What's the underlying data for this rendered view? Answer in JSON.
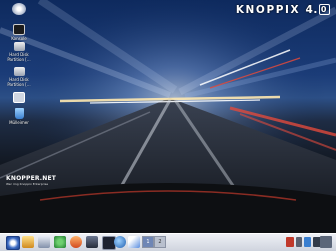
{
  "desktop": {
    "brand": {
      "name": "KNOPPIX",
      "version_major": "4.",
      "version_minor": "0"
    },
    "icons": [
      {
        "label": ""
      },
      {
        "label": "Konsole"
      },
      {
        "label": "Hard Disk\nPartition [..."
      },
      {
        "label": "Hard Disk\nPartition [..."
      },
      {
        "label": ""
      },
      {
        "label": "Mülleimer"
      }
    ],
    "watermark": {
      "title": "KNOPPER.NET",
      "subtitle": "Wer ring Knoppix Enterprise"
    }
  },
  "panel": {
    "buttons": [
      "kde-menu-icon",
      "home-icon",
      "terminal-icon",
      "kget-icon",
      "konqueror-icon",
      "monitor-icon",
      "terminal2-icon",
      "globe-icon",
      "feather-icon"
    ],
    "pager": [
      "1",
      "2"
    ],
    "tray": [
      "keyboard-icon",
      "speaker-icon",
      "network-icon",
      "battery-icon"
    ],
    "clock": ""
  },
  "colors": {
    "sky": "#1b3c78",
    "road": "#161b22",
    "panel": "#dfe3ea",
    "accent_red": "#e04a3c"
  }
}
